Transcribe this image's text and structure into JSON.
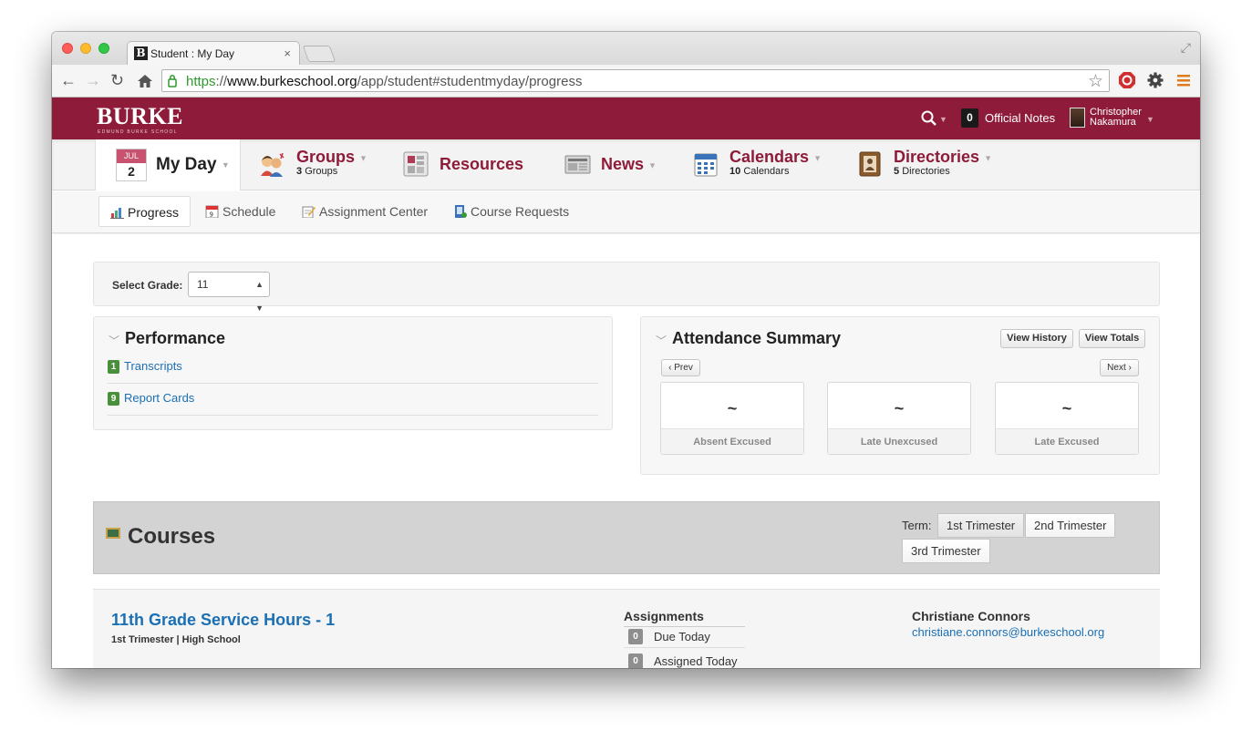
{
  "browser": {
    "tab_title": "Student : My Day",
    "tab_favicon": "B",
    "url_scheme": "https",
    "url_sep": "://",
    "url_host": "www.burkeschool.org",
    "url_path": "/app/student#studentmyday/progress"
  },
  "header": {
    "logo": "BURKE",
    "logo_sub": "EDMUND BURKE SCHOOL",
    "notes_count": "0",
    "notes_label": "Official Notes",
    "user_first": "Christopher",
    "user_last": "Nakamura",
    "brand_color": "#8e1b3a"
  },
  "nav": {
    "myday": {
      "month": "JUL",
      "day": "2",
      "label": "My Day"
    },
    "groups": {
      "label": "Groups",
      "count": "3",
      "count_label": "Groups",
      "icon": "people-icon"
    },
    "resources": {
      "label": "Resources",
      "icon": "resources-icon"
    },
    "news": {
      "label": "News",
      "icon": "newspaper-icon"
    },
    "calendars": {
      "label": "Calendars",
      "count": "10",
      "count_label": "Calendars",
      "icon": "calendar-icon"
    },
    "directories": {
      "label": "Directories",
      "count": "5",
      "count_label": "Directories",
      "icon": "address-book-icon"
    }
  },
  "subnav": {
    "progress": "Progress",
    "schedule": "Schedule",
    "assignment_center": "Assignment Center",
    "course_requests": "Course Requests"
  },
  "grade": {
    "label": "Select Grade:",
    "value": "11"
  },
  "performance": {
    "title": "Performance",
    "items": [
      {
        "count": "1",
        "label": "Transcripts"
      },
      {
        "count": "9",
        "label": "Report Cards"
      }
    ]
  },
  "attendance": {
    "title": "Attendance Summary",
    "view_history": "View History",
    "view_totals": "View Totals",
    "prev": "‹ Prev",
    "next": "Next ›",
    "cards": [
      {
        "value": "~",
        "label": "Absent Excused"
      },
      {
        "value": "~",
        "label": "Late Unexcused"
      },
      {
        "value": "~",
        "label": "Late Excused"
      }
    ]
  },
  "courses": {
    "title": "Courses",
    "term_label": "Term:",
    "terms": [
      "1st Trimester",
      "2nd Trimester",
      "3rd Trimester"
    ],
    "course": {
      "name": "11th Grade Service Hours - 1",
      "meta": "1st Trimester | High School",
      "assignments_title": "Assignments",
      "assignments": [
        {
          "count": "0",
          "label": "Due Today"
        },
        {
          "count": "0",
          "label": "Assigned Today"
        }
      ],
      "teacher_name": "Christiane Connors",
      "teacher_email": "christiane.connors@burkeschool.org"
    }
  }
}
